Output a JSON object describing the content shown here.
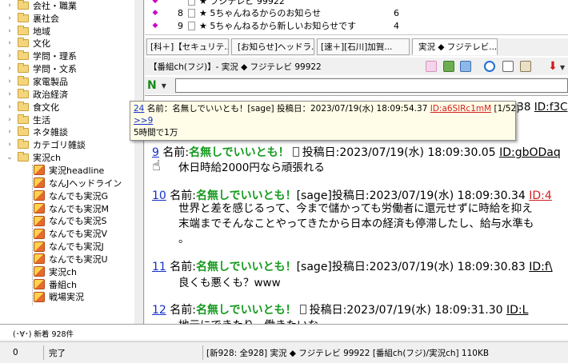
{
  "tree": {
    "items": [
      {
        "label": "会社・職業",
        "type": "folder",
        "expander": "›"
      },
      {
        "label": "裏社会",
        "type": "folder",
        "expander": "›"
      },
      {
        "label": "地域",
        "type": "folder",
        "expander": "›"
      },
      {
        "label": "文化",
        "type": "folder",
        "expander": "›"
      },
      {
        "label": "学問・理系",
        "type": "folder",
        "expander": "›"
      },
      {
        "label": "学問・文系",
        "type": "folder",
        "expander": "›"
      },
      {
        "label": "家電製品",
        "type": "folder",
        "expander": "›"
      },
      {
        "label": "政治経済",
        "type": "folder",
        "expander": "›"
      },
      {
        "label": "食文化",
        "type": "folder",
        "expander": "›"
      },
      {
        "label": "生活",
        "type": "folder",
        "expander": "›"
      },
      {
        "label": "ネタ雑談",
        "type": "folder",
        "expander": "›"
      },
      {
        "label": "カテゴリ雑談",
        "type": "folder",
        "expander": "›"
      },
      {
        "label": "実況ch",
        "type": "folder",
        "expander": "⌄"
      },
      {
        "label": "実況headline",
        "type": "board"
      },
      {
        "label": "なんJヘッドライン",
        "type": "board"
      },
      {
        "label": "なんでも実況G",
        "type": "board"
      },
      {
        "label": "なんでも実況M",
        "type": "board"
      },
      {
        "label": "なんでも実況S",
        "type": "board"
      },
      {
        "label": "なんでも実況V",
        "type": "board"
      },
      {
        "label": "なんでも実況J",
        "type": "board"
      },
      {
        "label": "なんでも実況U",
        "type": "board"
      },
      {
        "label": "実況ch",
        "type": "board"
      },
      {
        "label": "番組ch",
        "type": "board"
      },
      {
        "label": "戦場実況",
        "type": "board"
      }
    ]
  },
  "threads": [
    {
      "num": "",
      "title": "★ フジテレビ 99922",
      "res": ""
    },
    {
      "num": "8",
      "title": "★ 5ちゃんねるからのお知らせ",
      "res": "6"
    },
    {
      "num": "9",
      "title": "★ 5ちゃんねるから新しいお知らせです",
      "res": "4"
    }
  ],
  "tabs": [
    {
      "label": "[科＋]【セキュリテ..."
    },
    {
      "label": "[お知らせ]ヘッドラ..."
    },
    {
      "label": "[速＋][石川]加賀..."
    },
    {
      "label": "実況 ◆ フジテレビ..."
    }
  ],
  "info": {
    "title": "【番組ch(フジ)】- 実況 ◆ フジテレビ 99922"
  },
  "toolbar": {
    "nav_icon": "N",
    "arrow_icon": "▼"
  },
  "popup": {
    "header_num": "24",
    "header_text": "名前：名無しでいいとも！[sage] 投稿日：2023/07/19(水) 18:09:54.37 ",
    "header_id": "ID:a6SlRc1mM",
    "header_count": " [1/52]",
    "link": ">>9",
    "body": "5時間で1万"
  },
  "posts": [
    {
      "num": "9",
      "prefix": "名前:",
      "name": "名無しでいいとも！",
      "sage": "",
      "date": "投稿日:2023/07/19(水) 18:09:30.05 ",
      "id": "ID:gbODaq",
      "id_red": false,
      "body": [
        "休日時給2000円なら頑張れる"
      ]
    },
    {
      "num": "10",
      "prefix": "名前:",
      "name": "名無しでいいとも！",
      "sage": "[sage]",
      "date": "投稿日:2023/07/19(水) 18:09:30.34 ",
      "id": "ID:4",
      "id_red": true,
      "body": [
        "世界と差を感じるって、今まで儲かっても労働者に還元せずに時給を抑え",
        "末端までそんなことやってきたから日本の経済も停滞したし、給与水準も",
        "。"
      ]
    },
    {
      "num": "11",
      "prefix": "名前:",
      "name": "名無しでいいとも！",
      "sage": "[sage]",
      "date": "投稿日:2023/07/19(水) 18:09:30.83 ",
      "id": "ID:f\\",
      "id_red": false,
      "body": [
        "良くも悪くも？www"
      ]
    },
    {
      "num": "12",
      "prefix": "名前:",
      "name": "名無しでいいとも！",
      "sage": "",
      "date": "投稿日:2023/07/19(水) 18:09:31.30 ",
      "id": "ID:L",
      "id_red": false,
      "body": [
        "地元にできたり、働きたいな"
      ]
    }
  ],
  "top_right_fragment": {
    "text": ".38 ",
    "id": "ID:f3C"
  },
  "msgbar": {
    "text": "(･∀･) 新着 928件"
  },
  "status": {
    "left": "0",
    "state": "完了",
    "detail": "[新928: 全928] 実況 ◆ フジテレビ 99922  [番組ch(フジ)/実況ch]  110KB"
  }
}
